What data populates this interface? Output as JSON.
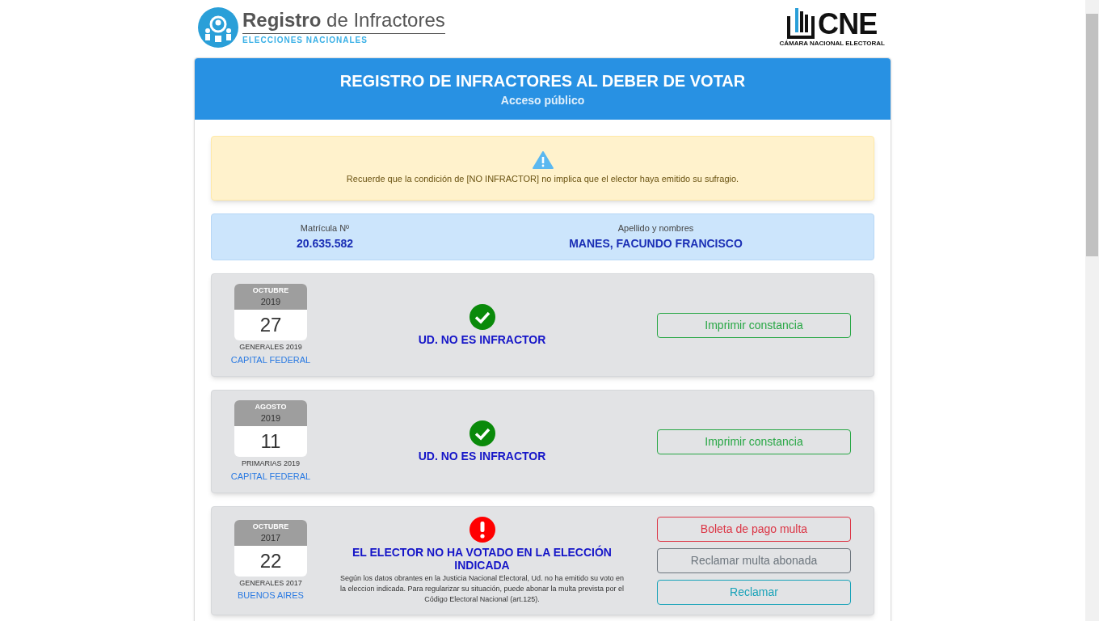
{
  "header": {
    "logo_title": "**Registro** de Infractores",
    "logo_subtitle": "ELECCIONES NACIONALES",
    "cne_mark": "CNE",
    "cne_caption": "CÁMARA NACIONAL ELECTORAL"
  },
  "panel": {
    "title": "REGISTRO DE INFRACTORES AL DEBER DE VOTAR",
    "subtitle": "Acceso público"
  },
  "notice": "Recuerde que la condición de [NO INFRACTOR] no implica que el elector haya emitido su sufragio.",
  "elector": {
    "matricula_label": "Matrícula Nº",
    "matricula": "20.635.582",
    "name_label": "Apellido y nombres",
    "name": "MANES, FACUNDO FRANCISCO"
  },
  "elections": [
    {
      "month": "OCTUBRE",
      "year": "2019",
      "day": "27",
      "election": "GENERALES 2019",
      "district": "CAPITAL FEDERAL",
      "kind": "ok",
      "result": "UD. NO ES INFRACTOR",
      "buttons": [
        {
          "label": "Imprimir constancia",
          "kind": "success"
        }
      ]
    },
    {
      "month": "AGOSTO",
      "year": "2019",
      "day": "11",
      "election": "PRIMARIAS 2019",
      "district": "CAPITAL FEDERAL",
      "kind": "ok",
      "result": "UD. NO ES INFRACTOR",
      "buttons": [
        {
          "label": "Imprimir constancia",
          "kind": "success"
        }
      ]
    },
    {
      "month": "OCTUBRE",
      "year": "2017",
      "day": "22",
      "election": "GENERALES 2017",
      "district": "BUENOS AIRES",
      "kind": "infractor",
      "result": "EL ELECTOR NO HA VOTADO EN LA ELECCIÓN INDICADA",
      "detail": "Según los datos obrantes en la Justicia Nacional Electoral, Ud. no ha emitido su voto en la eleccion indicada. Para regularizar su situación, puede abonar la multa prevista por el Código Electoral Nacional (art.125).",
      "buttons": [
        {
          "label": "Boleta de pago multa",
          "kind": "danger"
        },
        {
          "label": "Reclamar multa abonada",
          "kind": "secondary"
        },
        {
          "label": "Reclamar",
          "kind": "info"
        }
      ]
    }
  ]
}
